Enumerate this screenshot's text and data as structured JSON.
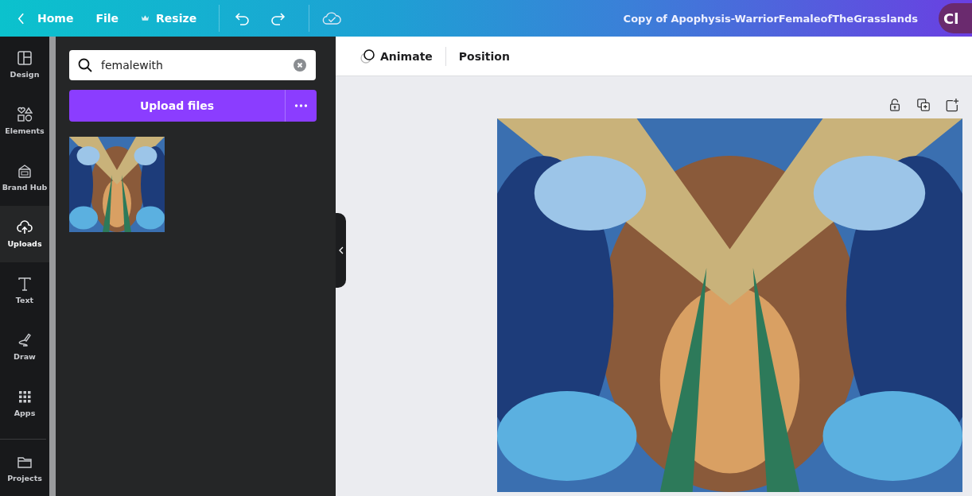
{
  "top_bar": {
    "back": "Home",
    "menu": [
      {
        "label": "File",
        "kind": "text"
      },
      {
        "label": "Resize",
        "kind": "crown"
      }
    ],
    "title": "Copy of Apophysis-WarriorFemaleofTheGrasslands",
    "avatar": "Cl"
  },
  "sidebar": {
    "items": [
      {
        "label": "Design",
        "kind": "layout",
        "selected": false
      },
      {
        "label": "Elements",
        "kind": "shapes",
        "selected": false
      },
      {
        "label": "Brand Hub",
        "kind": "brand",
        "selected": false
      },
      {
        "label": "Uploads",
        "kind": "upload",
        "selected": true
      },
      {
        "label": "Text",
        "kind": "text",
        "selected": false
      },
      {
        "label": "Draw",
        "kind": "draw",
        "selected": false
      },
      {
        "label": "Apps",
        "kind": "apps",
        "selected": false
      }
    ],
    "bottom": {
      "label": "Projects",
      "kind": "folder"
    }
  },
  "panel": {
    "search": {
      "value": "femalewith"
    },
    "upload_button": "Upload files"
  },
  "toolbar": {
    "items": [
      {
        "label": "Animate",
        "kind": "animate"
      },
      {
        "label": "Position",
        "kind": "plain"
      }
    ]
  }
}
